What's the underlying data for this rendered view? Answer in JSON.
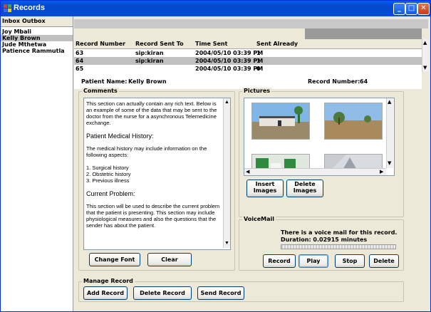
{
  "window": {
    "title": "Records"
  },
  "tabs": [
    {
      "label": "Inbox"
    },
    {
      "label": "Outbox"
    }
  ],
  "patients": [
    {
      "name": "Joy Mbali"
    },
    {
      "name": "Kelly Brown"
    },
    {
      "name": "Jude Mthetwa"
    },
    {
      "name": "Patience Rammutla"
    }
  ],
  "records": {
    "columns": [
      "Record Number",
      "Record Sent To",
      "Time Sent",
      "Sent Already"
    ],
    "rows": [
      {
        "number": "63",
        "to": "sip:kiran",
        "time": "2004/05/10 03:39 PM",
        "sent": "1"
      },
      {
        "number": "64",
        "to": "sip:kiran",
        "time": "2004/05/10 03:39 PM",
        "sent": "1"
      },
      {
        "number": "65",
        "to": "",
        "time": "2004/05/10 03:39 PM",
        "sent": "0"
      }
    ]
  },
  "patient_info": {
    "name_label": "Patient Name:",
    "name_value": "Kelly Brown",
    "record_label": "Record Number:",
    "record_value": "64"
  },
  "comments": {
    "title": "Comments",
    "p1": "This section can actually contain any rich text. Below is an example of some of the data that may be sent to the doctor from the nurse for a asynchronous Telemedicine exchange.",
    "h1": "Patient Medical History:",
    "p2": "The medical history may include information on the following aspects:",
    "l1": "1. Surgical history",
    "l2": "2. Obstetric history",
    "l3": "3. Previous illness",
    "h2": "Current Problem:",
    "p3": "This section will be used to describe the current problem that the patient is presenting. This section may include physiological measures and also the questions that the sender has about the patient.",
    "change_font": "Change Font",
    "clear": "Clear"
  },
  "pictures": {
    "title": "Pictures",
    "insert_line1": "Insert",
    "insert_line2": "Images",
    "delete_line1": "Delete",
    "delete_line2": "Images"
  },
  "voicemail": {
    "title": "VoiceMail",
    "status": "There is a voice mail for this record.",
    "duration": "Duration: 0.02915 minutes",
    "progress": 0,
    "record": "Record",
    "play": "Play",
    "stop": "Stop",
    "delete": "Delete"
  },
  "manage": {
    "title": "Manage Record",
    "add": "Add Record",
    "delete": "Delete Record",
    "send": "Send Record"
  },
  "colors": {
    "title_bar": "#0148c8",
    "selection": "#c0c0c0",
    "gray_panel": "#9a9a9a"
  }
}
